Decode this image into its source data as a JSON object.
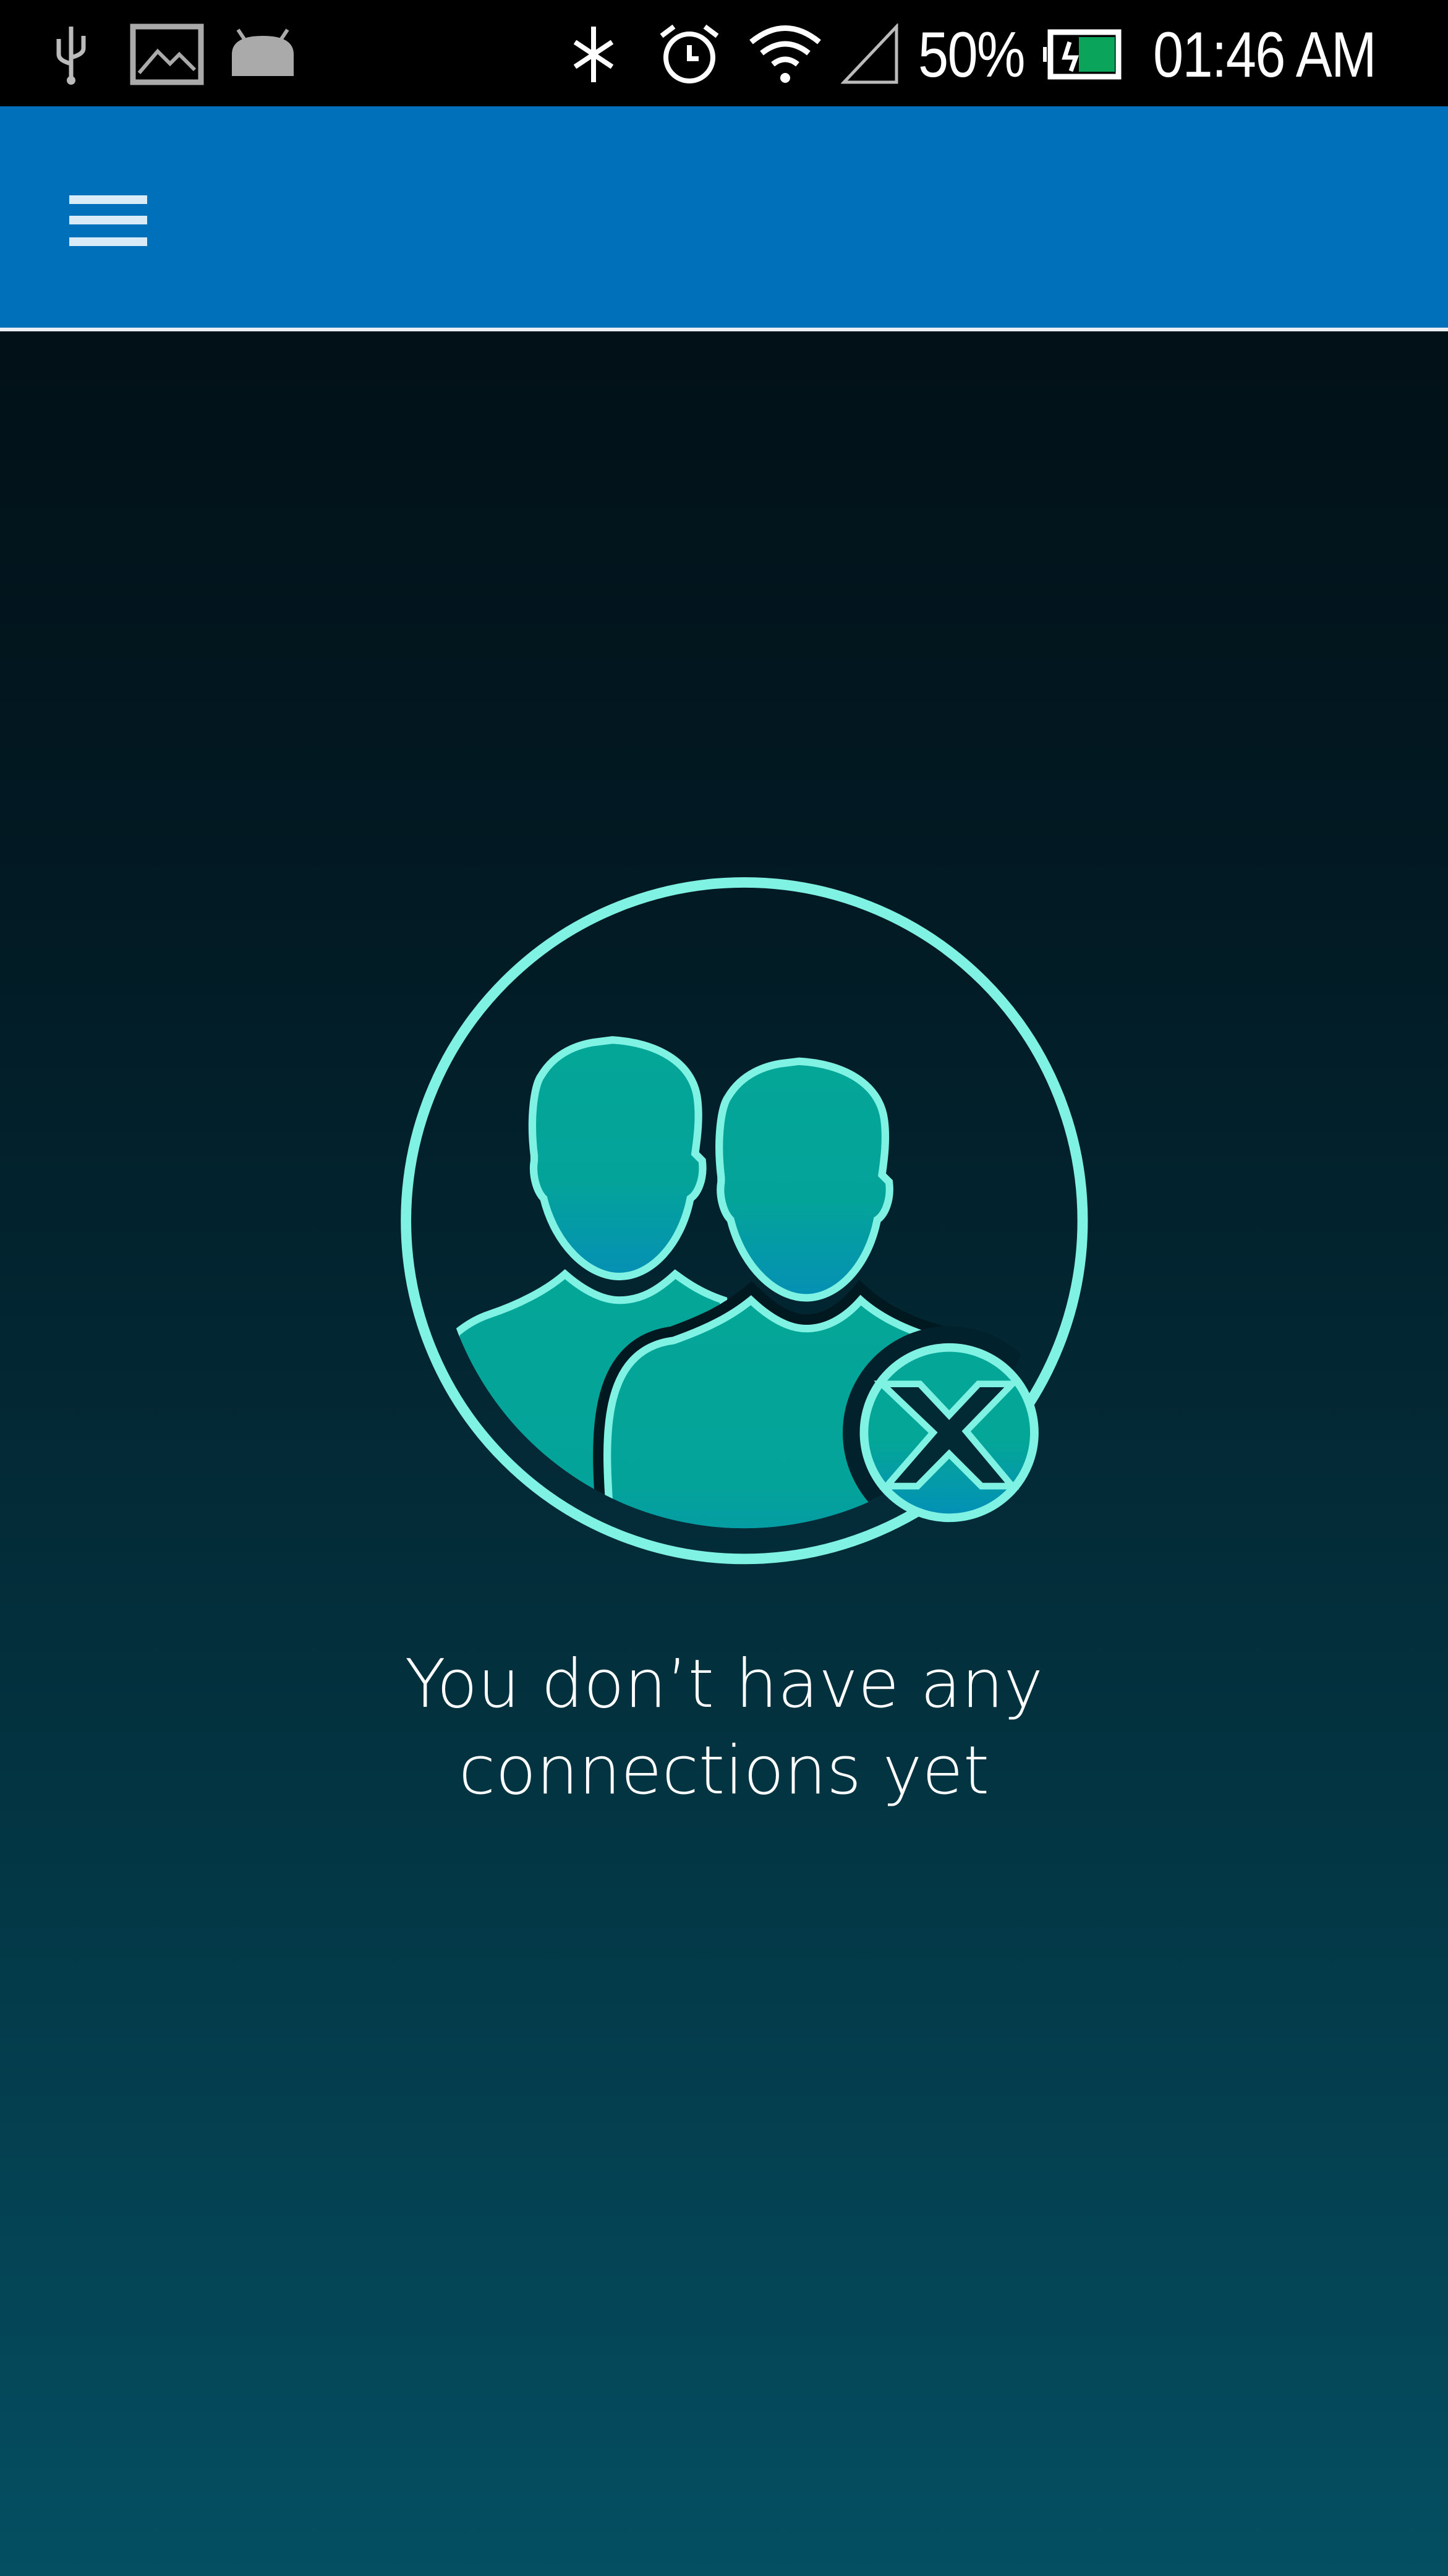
{
  "status_bar": {
    "left_icons": [
      "usb-icon",
      "image-icon",
      "android-icon"
    ],
    "right_icons": [
      "sync-icon",
      "alarm-icon",
      "wifi-icon",
      "signal-icon"
    ],
    "battery_percent": "50%",
    "battery_charging": true,
    "time": "01:46 AM"
  },
  "header": {
    "menu_icon": "hamburger-menu-icon",
    "color": "#0070bb"
  },
  "empty_state": {
    "icon": "users-remove-icon",
    "line1": "You don’t have any",
    "line2": "connections yet",
    "accent": "#7ff2e3"
  }
}
